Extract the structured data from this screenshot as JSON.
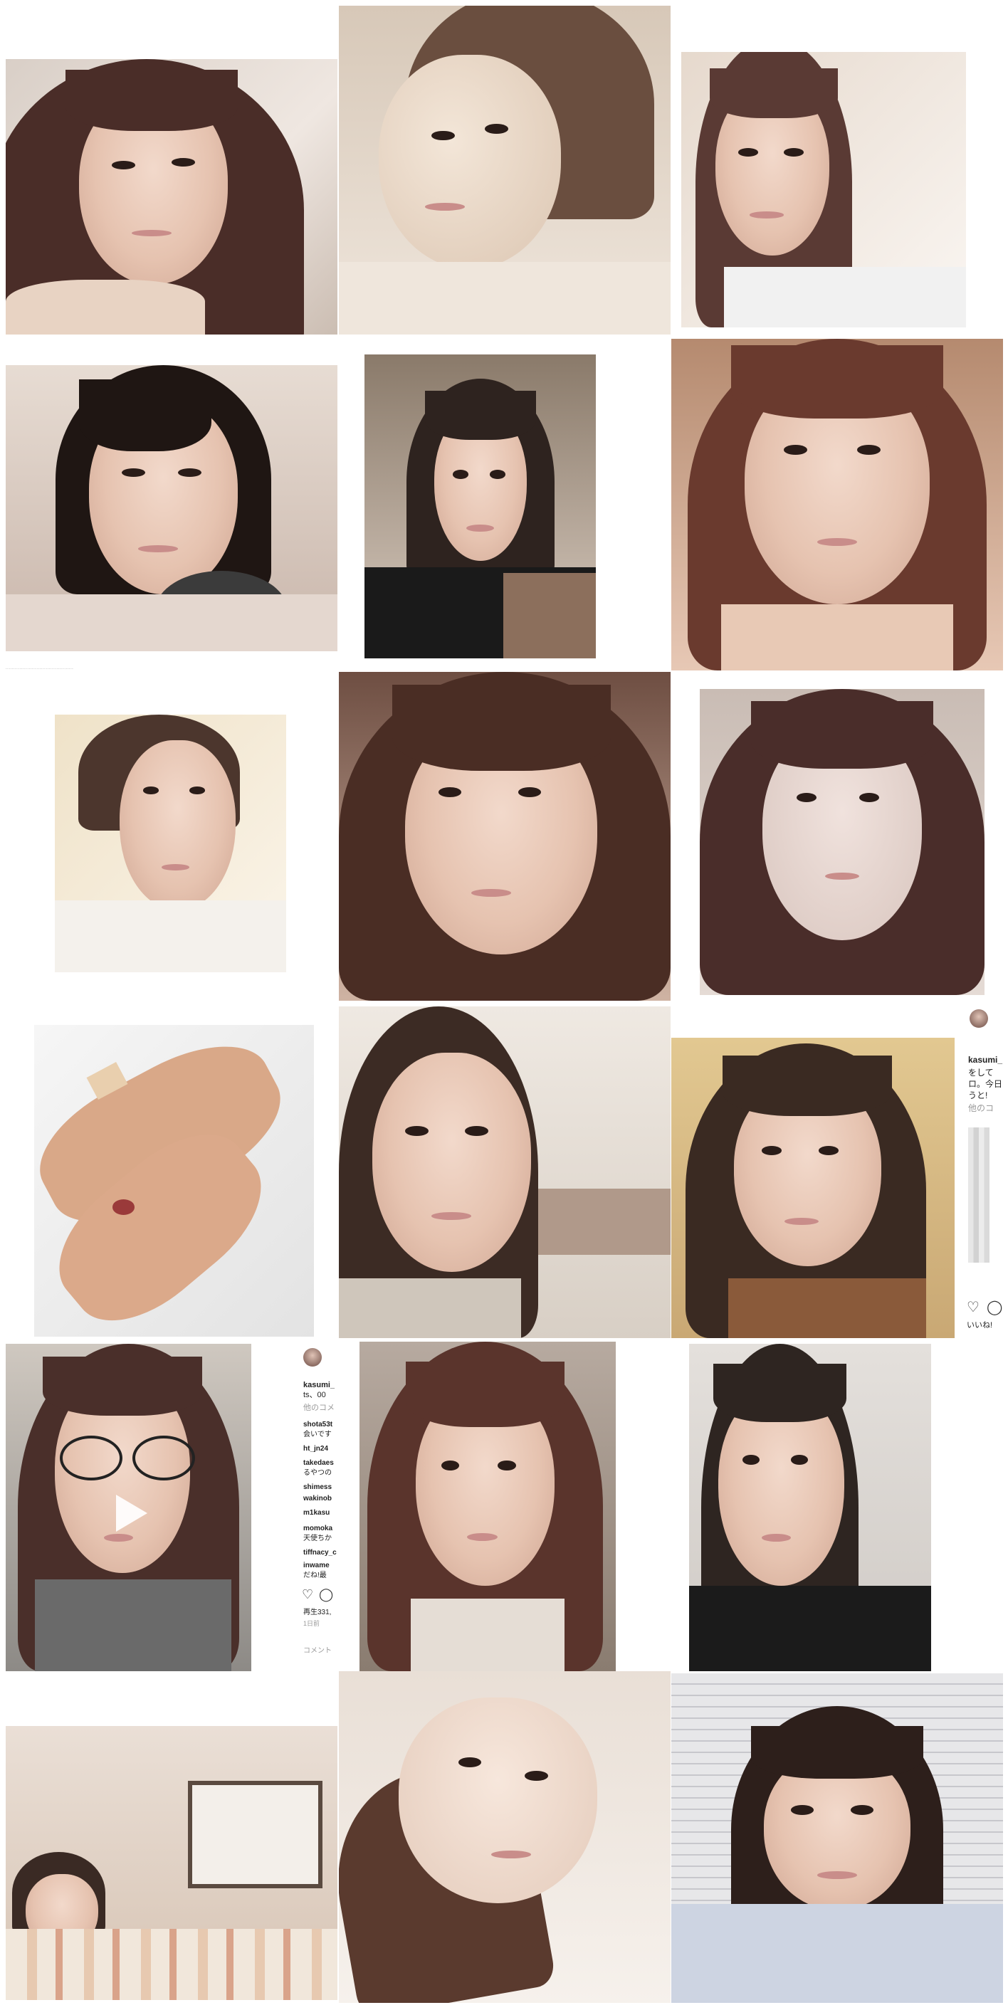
{
  "collage": {
    "photos": [
      {
        "name": "photo-01"
      },
      {
        "name": "photo-02"
      },
      {
        "name": "photo-03"
      },
      {
        "name": "photo-04"
      },
      {
        "name": "photo-05"
      },
      {
        "name": "photo-06"
      },
      {
        "name": "photo-07"
      },
      {
        "name": "photo-08"
      },
      {
        "name": "photo-09"
      },
      {
        "name": "photo-10"
      },
      {
        "name": "photo-11"
      },
      {
        "name": "photo-12"
      },
      {
        "name": "photo-13"
      },
      {
        "name": "photo-14"
      },
      {
        "name": "photo-15"
      },
      {
        "name": "photo-16"
      },
      {
        "name": "photo-17"
      },
      {
        "name": "photo-18"
      }
    ]
  },
  "ig_right": {
    "username": "kasumi_",
    "lines": [
      "をして",
      "ロ。今日",
      "うと!"
    ],
    "more": "他のコ"
  },
  "ig_middle": {
    "username": "kasumi_",
    "caption_line": "ts、00",
    "more": "他のコメ",
    "comments": [
      {
        "user": "shota53t",
        "text": "会いです"
      },
      {
        "user": "ht_jn24",
        "text": ""
      },
      {
        "user": "takedaes",
        "text": "るやつの"
      },
      {
        "user": "shimess",
        "text": ""
      },
      {
        "user": "wakinob",
        "text": ""
      },
      {
        "user": "m1kasu",
        "text": ""
      },
      {
        "user": "momoka",
        "text": "天使ちか"
      },
      {
        "user": "tiffnacy_c",
        "text": ""
      },
      {
        "user": "inwame",
        "text": "だね!最"
      }
    ],
    "views": "再生331,",
    "date": "1日前",
    "comment_prompt": "コメント"
  },
  "ig_right_likes": "いいね!",
  "tiny_caption": "............................................"
}
